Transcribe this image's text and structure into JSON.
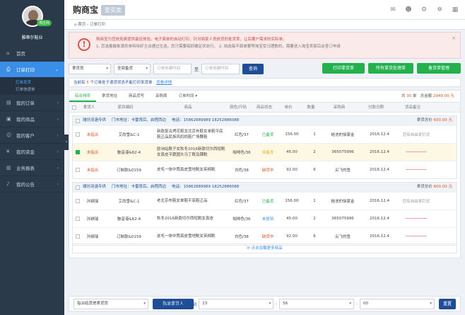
{
  "sidebar": {
    "badge": "供应商",
    "shop_name": "雅蒂尔鞋业",
    "items": [
      {
        "label": "首页",
        "icon": "home-icon"
      },
      {
        "label": "订单打印",
        "icon": "print-icon",
        "active": true
      },
      {
        "label": "我的订单",
        "icon": "order-icon"
      },
      {
        "label": "我的商品",
        "icon": "goods-icon"
      },
      {
        "label": "我的客户",
        "icon": "customer-icon"
      },
      {
        "label": "我的资金",
        "icon": "wallet-icon"
      },
      {
        "label": "业务报表",
        "icon": "report-icon"
      },
      {
        "label": "我的公告",
        "icon": "bell-icon"
      }
    ],
    "submenu": [
      "打单发货",
      "打单快递单"
    ]
  },
  "topbar": {
    "logo": "购商宝",
    "logo_sub": "爱买卖"
  },
  "breadcrumb": {
    "home": "首页",
    "current": "订单打印"
  },
  "alert": {
    "line1": "购商宝为您放免费提供最佳体验，电子面单的自动打印，针对商家人员放货的批货率，让后要户需求的实际单。",
    "line2": "1. 您选着摄象涌务单特待好主动通过生选，您只需要搞好确定状态行。   2. 拍选每不面单要等淘宝受马理数的，需要进入淘宝卖家后台查订申请"
  },
  "filter": {
    "sel1": "拿货员",
    "sel2": "全部备货",
    "date_from_placeholder": "订单创建时间",
    "to": "至",
    "date_to_placeholder": "订单创建时间",
    "query": "查询",
    "btn_print": "打印拿货单",
    "btn_all": "所有拿货处理单",
    "btn_manage": "备货单管理"
  },
  "info": {
    "prefix": "当前有",
    "count": "5",
    "suffix": "个订单处于退货状态不能打印发货单",
    "link": "查看详情"
  },
  "tabs": [
    "综合排序",
    "拿货地址",
    "商品货号",
    "采购周",
    "订单时间"
  ],
  "summary": {
    "count_prefix": "共",
    "count": "30",
    "count_suffix": "单",
    "amount_label": "总金额",
    "amount": "2949.00",
    "unit": "元"
  },
  "columns": [
    "",
    "拿货人",
    "家到编码",
    "商品",
    "颜色/尺码",
    "商品状态",
    "单价",
    "数量",
    "采购商",
    "付款日期",
    "货品备注"
  ],
  "groups": [
    {
      "buyer": "潍坊羽涵专供",
      "address": "门市地址：卡雷育后，启程西边",
      "phone": "电话：15862889989 18252886088",
      "pay_label": "拿货总价",
      "pay": "600.00",
      "pay_unit": "元",
      "rows": [
        {
          "picker": "未指派",
          "code": "艾尚雪&C-1",
          "name": "新款复古烤花鞋龙北京布鞋女单鞋平底鞋正品民族风妈妈鞋广场舞鞋",
          "spec": "红色/37",
          "status": "已备货",
          "price": "156.00",
          "qty": "1",
          "vendor": "蛙池的徐家金",
          "date": "2016.12.4",
          "note": "您有自由发钉式"
        },
        {
          "picker": "未指派",
          "code": "魅音港&62-4",
          "name": "欧洲站靴子女秋冬2016新款切尔西短靴女真皮平跟圆头马丁靴及踝靴",
          "spec": "咖啡色/36",
          "status": "待备货",
          "price": "45.00",
          "qty": "2",
          "vendor": "365075996",
          "date": "2016.12.4",
          "note": ""
        },
        {
          "picker": "未指派",
          "code": "订制款&0159",
          "name": "皮毛一体中筒真皮雪地靴女英棉靴",
          "spec": "白色/38",
          "status": "缺货中",
          "price": "92.00",
          "qty": "6",
          "vendor": "尖飞的鱼",
          "date": "2016.12.4",
          "note": ""
        }
      ]
    },
    {
      "buyer": "潍坊羽涵专供",
      "address": "门市地址：卡雷育后，启程西边",
      "phone": "电话：15862889989 18252886088",
      "pay_label": "拿货总价",
      "pay": "600.00",
      "pay_unit": "元",
      "rows": [
        {
          "picker": "孙颖瑞",
          "code": "艾尚雪&C-1",
          "name": "老北京布鞋女单鞋平底鞋正品",
          "spec": "红色/37",
          "status": "已备货",
          "price": "156.00",
          "qty": "1",
          "vendor": "蛙池的徐家金",
          "date": "2016.12.4",
          "note": "您有自由发钉式"
        },
        {
          "picker": "孙颖瑞",
          "code": "魅音港&62-4",
          "name": "秋冬2016新款切尔西短靴女真皮",
          "spec": "咖啡色/36",
          "status": "未提到",
          "price": "45.00",
          "qty": "2",
          "vendor": "365075996",
          "date": "2016.12.4",
          "note": ""
        },
        {
          "picker": "孙颖瑞",
          "code": "订制款&0159",
          "name": "皮毛一体中筒真皮雪地靴女英棉靴",
          "spec": "白色/38",
          "status": "缺货中",
          "price": "92.00",
          "qty": "6",
          "vendor": "尖飞的鱼",
          "date": "2016.12.4",
          "note": ""
        }
      ]
    }
  ],
  "more": "点击加载更多商品",
  "footer": {
    "select": "指派给其他拿货员",
    "assign": "指派拿货人",
    "auto_label": "自动指派截止到",
    "hour": "23",
    "minute": "56",
    "second": "00",
    "reset": "重置"
  },
  "colors": {
    "sidebar": "#2b3a4a",
    "active": "#3a8ee6",
    "green": "#22b14c",
    "navy": "#1f4e96",
    "orange": "#e0531f"
  }
}
